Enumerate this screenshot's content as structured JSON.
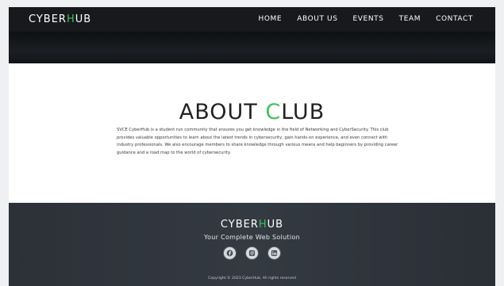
{
  "nav": {
    "brand_prefix": "CYBER",
    "brand_accent": "H",
    "brand_suffix": "UB",
    "items": [
      "HOME",
      "ABOUT US",
      "EVENTS",
      "TEAM",
      "CONTACT"
    ]
  },
  "about": {
    "title_prefix": "ABOUT ",
    "title_accent": "C",
    "title_suffix": "LUB",
    "body": "SVCE CyberHub is a student run community that ensures you get knowledge in the field of Networking and CyberSecurity. This club provides valuable opportunities to learn about the latest trends in cybersecurity, gain hands-on experience, and even connect with industry professionals. We also encourage members to share knowledge through various means and help beginners by providing career guidance and a road map to the world of cybersecurity."
  },
  "footer": {
    "brand_prefix": "CYBER",
    "brand_accent": "H",
    "brand_suffix": "UB",
    "tagline": "Your Complete Web Solution",
    "social_icons": [
      "facebook-icon",
      "instagram-icon",
      "linkedin-icon"
    ],
    "copyright": "Copyright © 2023 CyberHub. All rights reserved"
  },
  "colors": {
    "accent": "#3fc15c",
    "nav_bg": "#17191c",
    "footer_bg": "#30353c"
  }
}
